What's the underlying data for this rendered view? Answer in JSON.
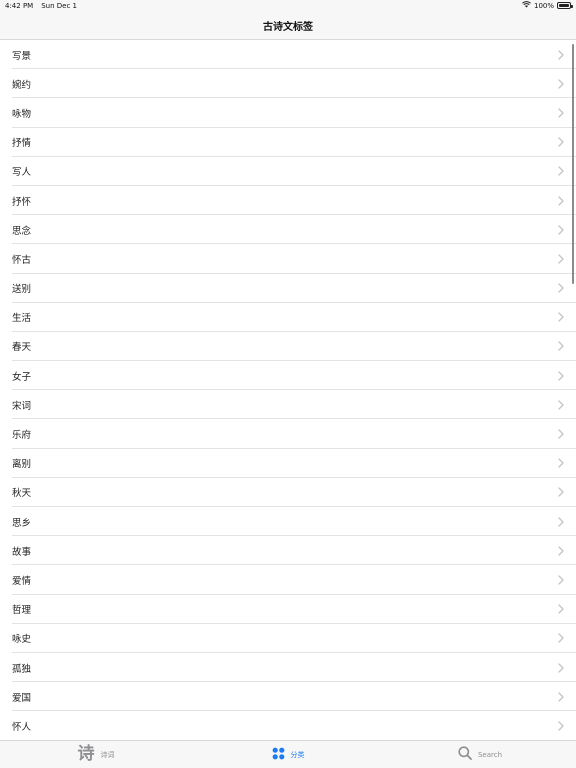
{
  "status_bar": {
    "time": "4:42 PM",
    "date": "Sun Dec 1",
    "battery": "100%",
    "battery_level": 1.0
  },
  "nav": {
    "title": "古诗文标签"
  },
  "tags": [
    "写景",
    "婉约",
    "咏物",
    "抒情",
    "写人",
    "抒怀",
    "思念",
    "怀古",
    "送别",
    "生活",
    "春天",
    "女子",
    "宋词",
    "乐府",
    "离别",
    "秋天",
    "思乡",
    "故事",
    "爱情",
    "哲理",
    "咏史",
    "孤独",
    "爱国",
    "怀人"
  ],
  "tab_bar": {
    "tabs": [
      {
        "label": "诗词",
        "icon": "poem-glyph-icon",
        "glyph": "诗",
        "active": false
      },
      {
        "label": "分类",
        "icon": "category-dots-icon",
        "active": true
      },
      {
        "label": "Search",
        "icon": "search-icon",
        "active": false
      }
    ]
  },
  "colors": {
    "accent": "#1e7cf2",
    "inactive": "#8e8e93",
    "chevron": "#c4c4c7",
    "separator": "#e3e3e3",
    "bar_background": "#f7f7f7"
  }
}
